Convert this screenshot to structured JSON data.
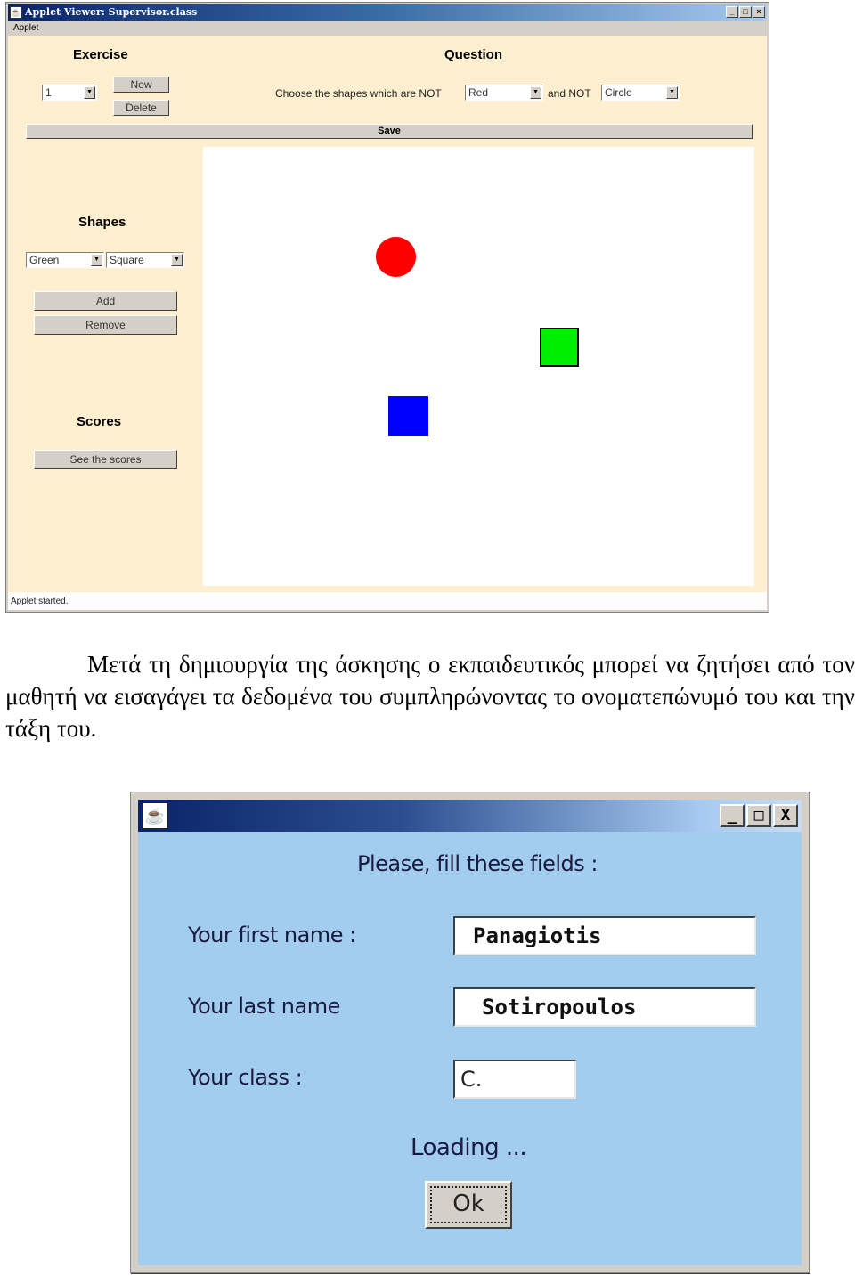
{
  "applet_window": {
    "title": "Applet Viewer: Supervisor.class",
    "title_icon": "java-applet-icon",
    "controls": {
      "minimize": "_",
      "maximize": "□",
      "close": "×"
    },
    "menu": [
      "Applet"
    ],
    "exercise": {
      "heading": "Exercise",
      "selected_exercise": "1",
      "new_label": "New",
      "delete_label": "Delete"
    },
    "question": {
      "heading": "Question",
      "prompt": "Choose the shapes which are NOT",
      "color_value": "Red",
      "connector": "and NOT",
      "shape_value": "Circle"
    },
    "save_label": "Save",
    "shapes_panel": {
      "heading": "Shapes",
      "color_value": "Green",
      "shape_value": "Square",
      "add_label": "Add",
      "remove_label": "Remove"
    },
    "scores_panel": {
      "heading": "Scores",
      "see_scores_label": "See the scores"
    },
    "canvas_shapes": [
      {
        "type": "circle",
        "color": "#ff0000",
        "outlined": false
      },
      {
        "type": "square",
        "color": "#00ee00",
        "outlined": true
      },
      {
        "type": "square",
        "color": "#0000ff",
        "outlined": false
      }
    ],
    "status": "Applet started."
  },
  "paragraph": "Μετά τη δημιουργία της άσκησης ο εκπαιδευτικός μπορεί να ζητήσει από τον μαθητή να εισαγάγει τα δεδομένα του συμπληρώνοντας το ονοματεπώνυμό του και την τάξη του.",
  "dialog": {
    "controls": {
      "minimize": "_",
      "maximize": "□",
      "close": "X"
    },
    "instruction": "Please, fill these fields :",
    "first_name_label": "Your first name :",
    "first_name_value": "Panagiotis",
    "last_name_label": "Your last name",
    "last_name_value": "Sotiropoulos",
    "class_label": "Your class :",
    "class_value": "C.",
    "loading_text": "Loading ...",
    "ok_label": "Ok"
  },
  "colors": {
    "applet_bg": "#fdefcf",
    "dialog_bg": "#a3cdee",
    "title_bar": "#0a246a"
  }
}
